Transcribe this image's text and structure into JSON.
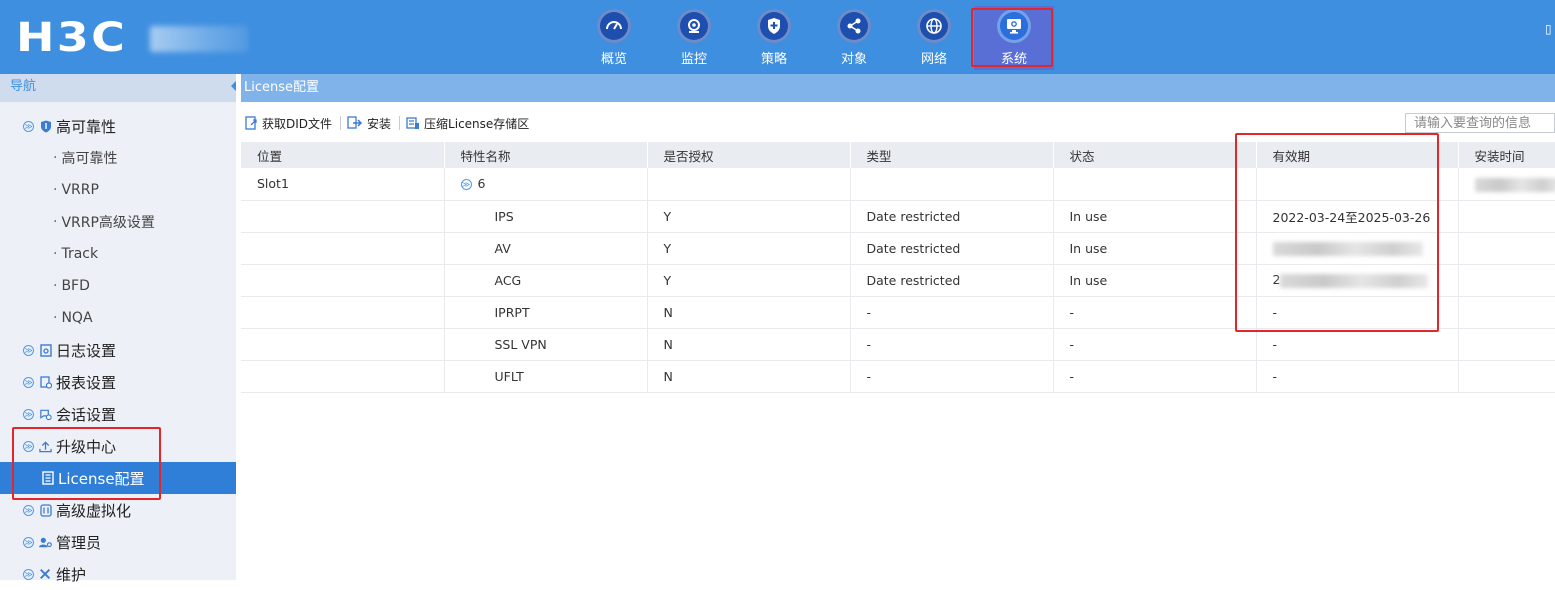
{
  "brand": {
    "logo_text": "H3C"
  },
  "nav": {
    "items": [
      {
        "label": "概览",
        "icon": "dashboard-icon"
      },
      {
        "label": "监控",
        "icon": "monitor-icon"
      },
      {
        "label": "策略",
        "icon": "shield-icon"
      },
      {
        "label": "对象",
        "icon": "share-icon"
      },
      {
        "label": "网络",
        "icon": "globe-icon"
      },
      {
        "label": "系统",
        "icon": "system-icon",
        "active": true
      }
    ]
  },
  "sidebar": {
    "title": "导航",
    "items": [
      {
        "label": "高可靠性",
        "type": "group",
        "icon": "shield-icon"
      },
      {
        "label": "高可靠性",
        "type": "child"
      },
      {
        "label": "VRRP",
        "type": "child"
      },
      {
        "label": "VRRP高级设置",
        "type": "child"
      },
      {
        "label": "Track",
        "type": "child"
      },
      {
        "label": "BFD",
        "type": "child"
      },
      {
        "label": "NQA",
        "type": "child"
      },
      {
        "label": "日志设置",
        "type": "group",
        "icon": "log-icon"
      },
      {
        "label": "报表设置",
        "type": "group",
        "icon": "report-icon"
      },
      {
        "label": "会话设置",
        "type": "group",
        "icon": "session-icon"
      },
      {
        "label": "升级中心",
        "type": "group",
        "icon": "upload-icon"
      },
      {
        "label": "License配置",
        "type": "selected",
        "icon": "license-icon"
      },
      {
        "label": "高级虚拟化",
        "type": "group",
        "icon": "virtualization-icon"
      },
      {
        "label": "管理员",
        "type": "group",
        "icon": "admin-icon"
      },
      {
        "label": "维护",
        "type": "group",
        "icon": "tools-icon"
      }
    ]
  },
  "main": {
    "title": "License配置",
    "toolbar": {
      "get_did": "获取DID文件",
      "install": "安装",
      "compress": "压缩License存储区",
      "search_placeholder": "请输入要查询的信息"
    },
    "table": {
      "headers": [
        "位置",
        "特性名称",
        "是否授权",
        "类型",
        "状态",
        "有效期",
        "安装时间"
      ],
      "slot": {
        "location": "Slot1",
        "count": "6"
      },
      "rows": [
        {
          "feature": "IPS",
          "authorized": "Y",
          "type": "Date restricted",
          "status": "In use",
          "validity": "2022-03-24至2025-03-26"
        },
        {
          "feature": "AV",
          "authorized": "Y",
          "type": "Date restricted",
          "status": "In use",
          "validity": ""
        },
        {
          "feature": "ACG",
          "authorized": "Y",
          "type": "Date restricted",
          "status": "In use",
          "validity": "2"
        },
        {
          "feature": "IPRPT",
          "authorized": "N",
          "type": "-",
          "status": "-",
          "validity": "-"
        },
        {
          "feature": "SSL VPN",
          "authorized": "N",
          "type": "-",
          "status": "-",
          "validity": "-"
        },
        {
          "feature": "UFLT",
          "authorized": "N",
          "type": "-",
          "status": "-",
          "validity": "-"
        }
      ]
    }
  },
  "colors": {
    "topbar": "#3f8fe0",
    "selected": "#2f7fd9",
    "highlight_box": "#e3262a"
  }
}
